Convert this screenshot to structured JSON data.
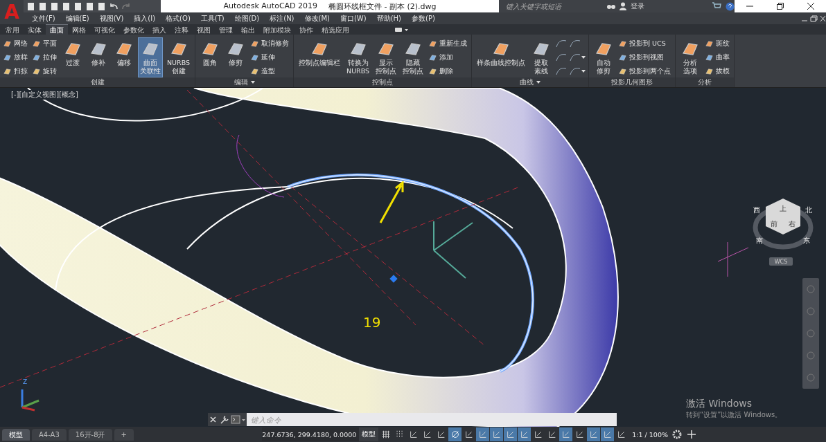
{
  "app_button": {
    "letter": "A"
  },
  "title": {
    "app": "Autodesk AutoCAD 2019",
    "file": "椭圆环线框文件 - 副本 (2).dwg"
  },
  "search": {
    "placeholder": "键入关键字或短语"
  },
  "sign_in": "登录",
  "menus": [
    "文件(F)",
    "编辑(E)",
    "视图(V)",
    "插入(I)",
    "格式(O)",
    "工具(T)",
    "绘图(D)",
    "标注(N)",
    "修改(M)",
    "窗口(W)",
    "帮助(H)",
    "参数(P)"
  ],
  "tabs": [
    {
      "label": "常用",
      "selected": false
    },
    {
      "label": "实体",
      "selected": false
    },
    {
      "label": "曲面",
      "selected": true
    },
    {
      "label": "网格",
      "selected": false
    },
    {
      "label": "可视化",
      "selected": false
    },
    {
      "label": "参数化",
      "selected": false
    },
    {
      "label": "插入",
      "selected": false
    },
    {
      "label": "注释",
      "selected": false
    },
    {
      "label": "视图",
      "selected": false
    },
    {
      "label": "管理",
      "selected": false
    },
    {
      "label": "输出",
      "selected": false
    },
    {
      "label": "附加模块",
      "selected": false
    },
    {
      "label": "协作",
      "selected": false
    },
    {
      "label": "精选应用",
      "selected": false
    }
  ],
  "panels": [
    {
      "title": "创建",
      "has_menu": false,
      "columns": [
        {
          "kind": "small",
          "items": [
            {
              "label": "网络"
            },
            {
              "label": "放样"
            },
            {
              "label": "扫掠"
            }
          ]
        },
        {
          "kind": "small",
          "items": [
            {
              "label": "平面"
            },
            {
              "label": "拉伸"
            },
            {
              "label": "旋转"
            }
          ]
        },
        {
          "kind": "large",
          "items": [
            {
              "lines": [
                "过渡"
              ],
              "selected": false
            },
            {
              "lines": [
                "修补"
              ],
              "selected": false
            },
            {
              "lines": [
                "偏移"
              ],
              "selected": false
            },
            {
              "lines": [
                "曲面",
                "关联性"
              ],
              "selected": true
            },
            {
              "lines": [
                "NURBS",
                "创建"
              ],
              "selected": false
            }
          ]
        }
      ]
    },
    {
      "title": "编辑",
      "has_menu": true,
      "columns": [
        {
          "kind": "large",
          "items": [
            {
              "lines": [
                "圆角"
              ],
              "selected": false
            },
            {
              "lines": [
                "修剪"
              ],
              "selected": false
            }
          ]
        },
        {
          "kind": "small",
          "items": [
            {
              "label": "取消修剪"
            },
            {
              "label": "延伸"
            },
            {
              "label": "造型"
            }
          ]
        }
      ]
    },
    {
      "title": "控制点",
      "has_menu": false,
      "columns": [
        {
          "kind": "large",
          "items": [
            {
              "lines": [
                "控制点编辑栏"
              ],
              "selected": false
            },
            {
              "lines": [
                "转换为",
                "NURBS"
              ],
              "selected": false
            },
            {
              "lines": [
                "显示",
                "控制点"
              ],
              "selected": false
            },
            {
              "lines": [
                "隐藏",
                "控制点"
              ],
              "selected": false
            }
          ]
        },
        {
          "kind": "small",
          "items": [
            {
              "label": "重新生成"
            },
            {
              "label": "添加"
            },
            {
              "label": "删除"
            }
          ]
        }
      ]
    },
    {
      "title": "曲线",
      "has_menu": true,
      "columns": [
        {
          "kind": "large",
          "items": [
            {
              "lines": [
                "样条曲线控制点"
              ],
              "selected": false
            },
            {
              "lines": [
                "提取",
                "素线"
              ],
              "selected": false
            }
          ]
        },
        {
          "kind": "icons",
          "items": [
            {
              "dropdown": false
            },
            {
              "dropdown": false
            },
            {
              "dropdown": false
            }
          ]
        },
        {
          "kind": "icons",
          "items": [
            {
              "dropdown": false
            },
            {
              "dropdown": true
            },
            {
              "dropdown": true
            }
          ]
        }
      ]
    },
    {
      "title": "投影几何图形",
      "has_menu": false,
      "columns": [
        {
          "kind": "large",
          "items": [
            {
              "lines": [
                "自动",
                "修剪"
              ],
              "selected": false
            }
          ]
        },
        {
          "kind": "small",
          "items": [
            {
              "label": "投影到 UCS"
            },
            {
              "label": "投影到视图"
            },
            {
              "label": "投影到两个点"
            }
          ]
        }
      ]
    },
    {
      "title": "分析",
      "has_menu": false,
      "columns": [
        {
          "kind": "large",
          "items": [
            {
              "lines": [
                "分析",
                "选项"
              ],
              "selected": false
            }
          ]
        },
        {
          "kind": "small",
          "items": [
            {
              "label": "斑纹"
            },
            {
              "label": "曲率"
            },
            {
              "label": "拔模"
            }
          ]
        }
      ]
    }
  ],
  "viewport": {
    "label": "[-][自定义视图][概念]",
    "annotation": "19",
    "cube_faces": [
      "上",
      "前",
      "右"
    ],
    "compass": [
      "西",
      "北",
      "南",
      "东"
    ],
    "ucs_menu": "WCS",
    "ucs_axis": "Z"
  },
  "command_line": {
    "placeholder": "键入命令"
  },
  "activation": {
    "title": "激活 Windows",
    "subtitle": "转到“设置”以激活 Windows。"
  },
  "layout_tabs": [
    {
      "label": "模型",
      "selected": true
    },
    {
      "label": "A4-A3",
      "selected": false
    },
    {
      "label": "16开-8开",
      "selected": false
    }
  ],
  "add_tab": "+",
  "coordinates": "247.6736, 299.4180, 0.0000",
  "space": "模型",
  "status_toggles": [
    {
      "kind": "grid",
      "on": false
    },
    {
      "kind": "snap",
      "on": false
    },
    {
      "kind": "infer",
      "on": false
    },
    {
      "kind": "dynamic",
      "on": false
    },
    {
      "kind": "ortho",
      "on": false
    },
    {
      "kind": "polar",
      "on": true
    },
    {
      "kind": "isodraft",
      "on": false
    },
    {
      "kind": "otrack",
      "on": true
    },
    {
      "kind": "osnap",
      "on": true
    },
    {
      "kind": "lineweight",
      "on": true
    },
    {
      "kind": "transparency",
      "on": true
    },
    {
      "kind": "cycle",
      "on": false
    },
    {
      "kind": "osnap3d",
      "on": false
    },
    {
      "kind": "ucs",
      "on": true
    },
    {
      "kind": "gizmo",
      "on": false
    },
    {
      "kind": "annotate",
      "on": true
    },
    {
      "kind": "annoscale",
      "on": true
    },
    {
      "kind": "annovis",
      "on": false
    }
  ],
  "scale": "1:1 / 100%"
}
